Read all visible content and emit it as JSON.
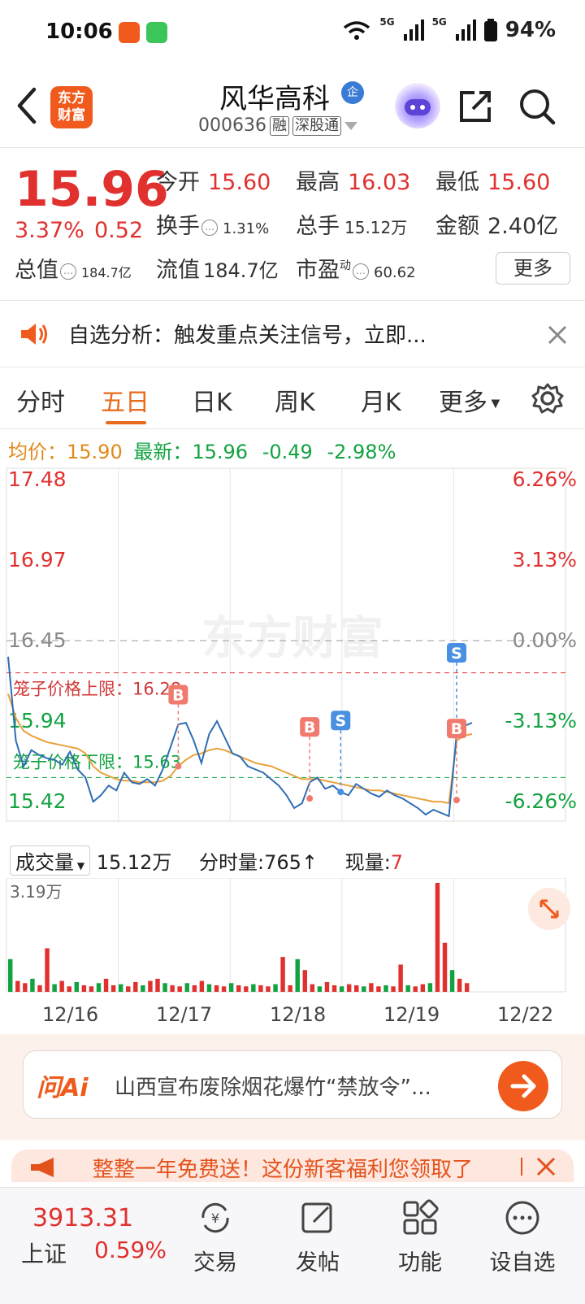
{
  "status_bar": {
    "time": "10:06",
    "battery": "94%",
    "net1": "5G",
    "net2": "5G"
  },
  "header": {
    "logo_line1": "东方",
    "logo_line2": "财富",
    "stock_name": "风华高科",
    "qi_badge": "企",
    "code": "000636",
    "tag1": "融",
    "tag2": "深股通"
  },
  "quote": {
    "price": "15.96",
    "change_pct": "3.37%",
    "change_val": "0.52",
    "open_label": "今开",
    "open": "15.60",
    "high_label": "最高",
    "high": "16.03",
    "low_label": "最低",
    "low": "15.60",
    "turnover_label": "换手",
    "turnover": "1.31%",
    "volume_label": "总手",
    "volume": "15.12万",
    "amount_label": "金额",
    "amount": "2.40亿",
    "mktcap_label": "总值",
    "mktcap": "184.7亿",
    "float_label": "流值",
    "float_cap": "184.7亿",
    "pe_label": "市盈",
    "pe_sup": "动",
    "pe": "60.62",
    "more_label": "更多"
  },
  "notice": {
    "text": "自选分析：触发重点关注信号，立即..."
  },
  "tabs": [
    "分时",
    "五日",
    "日K",
    "周K",
    "月K",
    "更多"
  ],
  "active_tab": 1,
  "legend": {
    "avg_label": "均价：",
    "avg": "15.90",
    "last_label": "最新：",
    "last": "15.96",
    "chg": "-0.49",
    "chg_pct": "-2.98%"
  },
  "chart_data": {
    "type": "line",
    "title": "",
    "x_categories": [
      "12/16",
      "12/17",
      "12/18",
      "12/19",
      "12/22"
    ],
    "y_labels_left": [
      "17.48",
      "16.97",
      "16.45",
      "15.94",
      "15.42"
    ],
    "y_labels_right": [
      "6.26%",
      "3.13%",
      "0.00%",
      "-3.13%",
      "-6.26%"
    ],
    "ylim": [
      15.42,
      17.48
    ],
    "prev_close": 16.45,
    "price_series": [
      16.38,
      15.86,
      15.7,
      15.8,
      15.77,
      15.75,
      15.74,
      15.71,
      15.79,
      15.68,
      15.63,
      15.48,
      15.52,
      15.58,
      15.55,
      15.66,
      15.6,
      15.59,
      15.62,
      15.58,
      15.68,
      15.82,
      15.96,
      15.97,
      15.86,
      15.72,
      15.9,
      15.98,
      15.88,
      15.78,
      15.76,
      15.7,
      15.68,
      15.66,
      15.62,
      15.58,
      15.52,
      15.44,
      15.47,
      15.6,
      15.63,
      15.56,
      15.58,
      15.54,
      15.52,
      15.59,
      15.56,
      15.53,
      15.51,
      15.55,
      15.52,
      15.5,
      15.47,
      15.44,
      15.4,
      15.43,
      15.41,
      15.39,
      15.9,
      15.95,
      15.97
    ],
    "avg_series": [
      16.15,
      16.0,
      15.92,
      15.89,
      15.87,
      15.85,
      15.84,
      15.83,
      15.82,
      15.81,
      15.78,
      15.7,
      15.66,
      15.64,
      15.62,
      15.61,
      15.61,
      15.6,
      15.6,
      15.6,
      15.61,
      15.64,
      15.7,
      15.74,
      15.77,
      15.78,
      15.8,
      15.81,
      15.8,
      15.78,
      15.76,
      15.74,
      15.72,
      15.71,
      15.7,
      15.68,
      15.66,
      15.64,
      15.62,
      15.62,
      15.62,
      15.61,
      15.6,
      15.59,
      15.58,
      15.57,
      15.56,
      15.55,
      15.55,
      15.54,
      15.53,
      15.52,
      15.51,
      15.5,
      15.49,
      15.48,
      15.48,
      15.47,
      15.86,
      15.89,
      15.9
    ],
    "limit_up_label": "笼子价格上限：16.28",
    "limit_up": 16.28,
    "limit_down_label": "笼子价格下限：15.63",
    "limit_down": 15.63,
    "markers": [
      {
        "type": "B",
        "index": 22,
        "price": 15.7
      },
      {
        "type": "B",
        "index": 39,
        "price": 15.5
      },
      {
        "type": "S",
        "index": 43,
        "price": 15.54
      },
      {
        "type": "S",
        "index": 58,
        "price": 15.96
      },
      {
        "type": "B",
        "index": 58,
        "price": 15.49
      }
    ],
    "volume_max_label": "3.19万",
    "volume_series": [
      0.3,
      0.1,
      0.08,
      0.12,
      0.06,
      0.4,
      0.07,
      0.1,
      0.05,
      0.09,
      0.06,
      0.05,
      0.08,
      0.12,
      0.06,
      0.07,
      0.05,
      0.09,
      0.06,
      0.1,
      0.12,
      0.08,
      0.06,
      0.05,
      0.08,
      0.06,
      0.1,
      0.07,
      0.06,
      0.05,
      0.08,
      0.06,
      0.05,
      0.07,
      0.06,
      0.05,
      0.07,
      0.32,
      0.06,
      0.3,
      0.2,
      0.07,
      0.05,
      0.09,
      0.06,
      0.05,
      0.07,
      0.06,
      0.05,
      0.08,
      0.05,
      0.06,
      0.05,
      0.25,
      0.06,
      0.05,
      0.07,
      0.08,
      1.0,
      0.45,
      0.2,
      0.12,
      0.08
    ]
  },
  "volume_bar": {
    "selector": "成交量",
    "total": "15.12万",
    "tick_label": "分时量:",
    "tick": "765↑",
    "now_label": "现量:",
    "now": "7"
  },
  "ai": {
    "brand": "问Ai",
    "text": "山西宣布废除烟花爆竹“禁放令”..."
  },
  "promo": {
    "text": "整整一年免费送！这份新客福利您领取了"
  },
  "bottom_nav": {
    "index_value": "3913.31",
    "index_name": "上证",
    "index_pct": "0.59%",
    "trade": "交易",
    "post": "发帖",
    "func": "功能",
    "add_watch": "设自选"
  },
  "colors": {
    "up": "#e0312f",
    "down": "#12a341",
    "accent": "#e86a1a",
    "price_line": "#2f6db5",
    "avg_line": "#e9a23b"
  }
}
